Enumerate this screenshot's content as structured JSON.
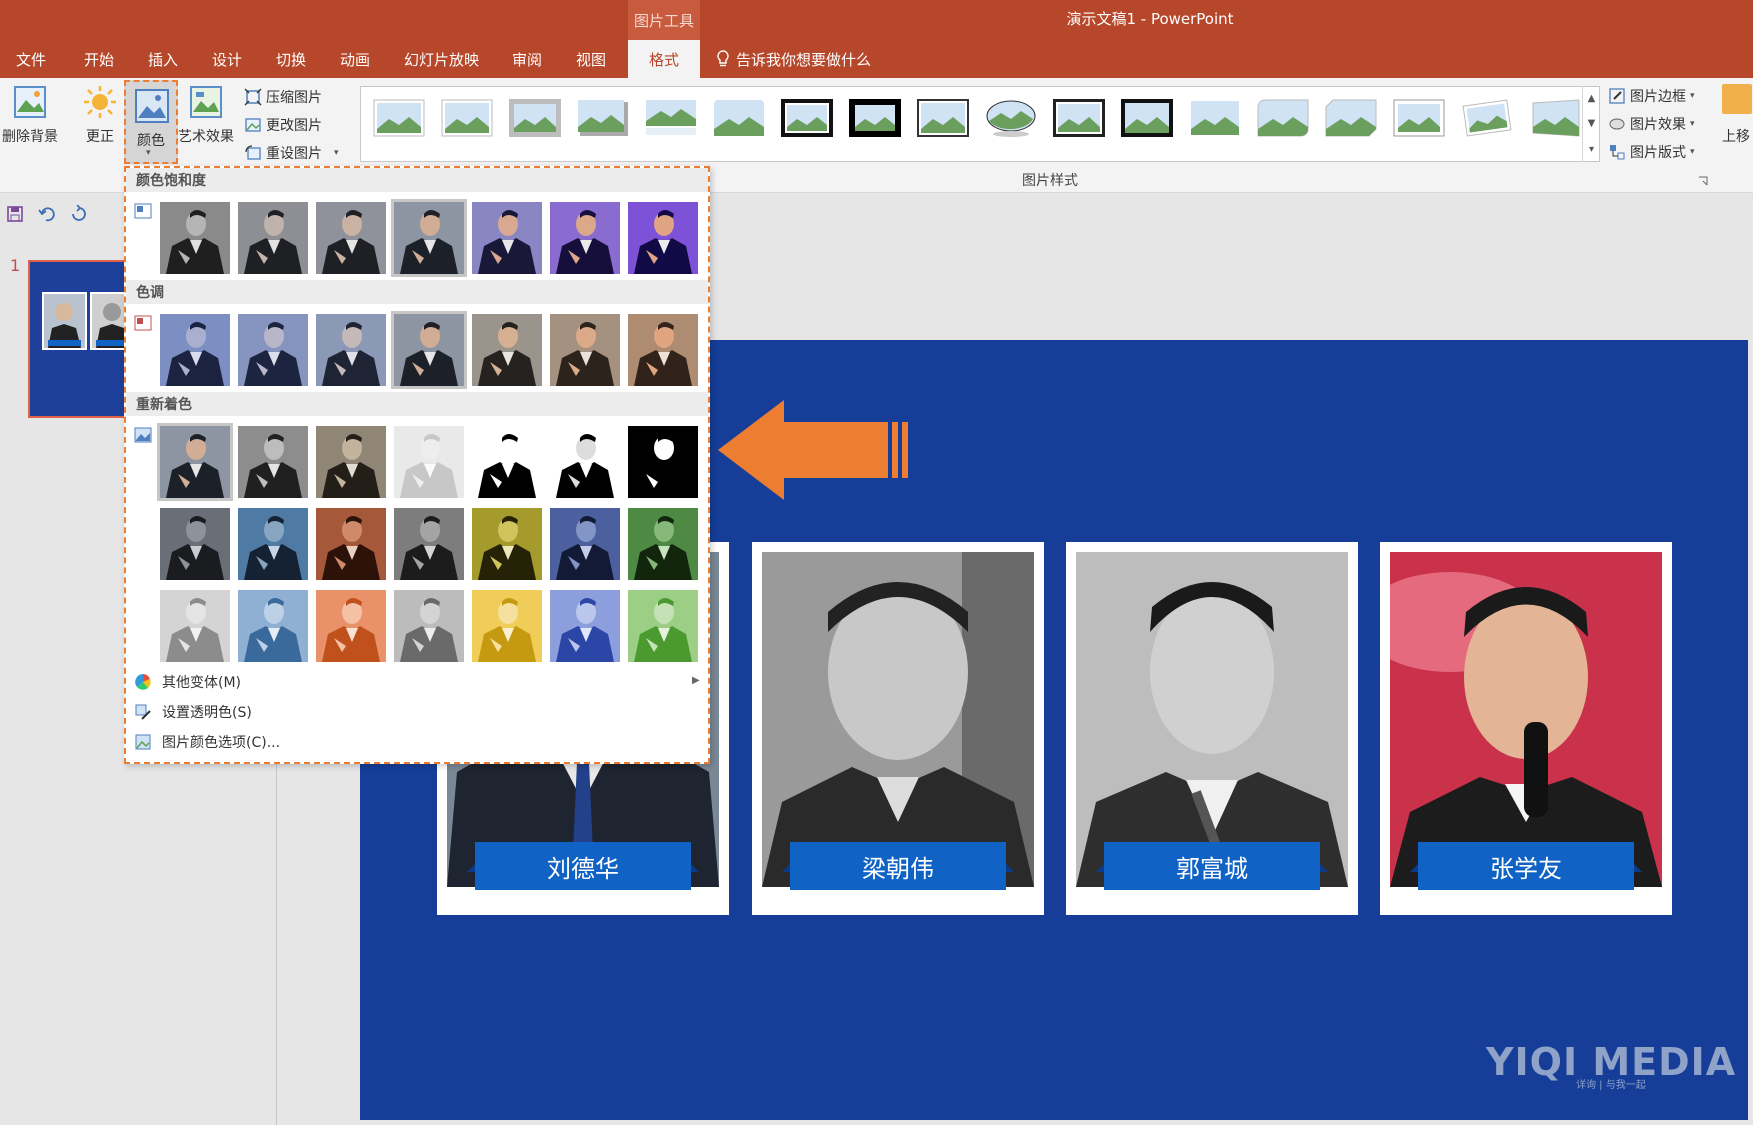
{
  "window": {
    "title": "演示文稿1 - PowerPoint",
    "context_tab_group": "图片工具"
  },
  "tabs": [
    "文件",
    "开始",
    "插入",
    "设计",
    "切换",
    "动画",
    "幻灯片放映",
    "审阅",
    "视图",
    "格式"
  ],
  "active_tab": "格式",
  "tell_me": "告诉我你想要做什么",
  "ribbon": {
    "remove_bg": "删除背景",
    "corrections": "更正",
    "color": "颜色",
    "artistic": "艺术效果",
    "compress": "压缩图片",
    "change": "更改图片",
    "reset": "重设图片",
    "styles_group": "图片样式",
    "border": "图片边框",
    "effects": "图片效果",
    "layout": "图片版式",
    "bring_forward": "上移"
  },
  "slide_pane": {
    "slide_number": "1"
  },
  "color_menu": {
    "saturation_header": "颜色饱和度",
    "tone_header": "色调",
    "recolor_header": "重新着色",
    "more_variations": "其他变体(M)",
    "set_transparent": "设置透明色(S)",
    "color_options": "图片颜色选项(C)..."
  },
  "slide": {
    "cards": [
      {
        "name": "刘德华"
      },
      {
        "name": "梁朝伟"
      },
      {
        "name": "郭富城"
      },
      {
        "name": "张学友"
      }
    ],
    "watermark": "YIQI MEDIA",
    "watermark_sub": "详询 | 与我一起"
  },
  "colors": {
    "accent": "#b7472a",
    "highlight": "#ed7d31",
    "slide_bg": "#163e99",
    "name_bar": "#1063c5"
  }
}
